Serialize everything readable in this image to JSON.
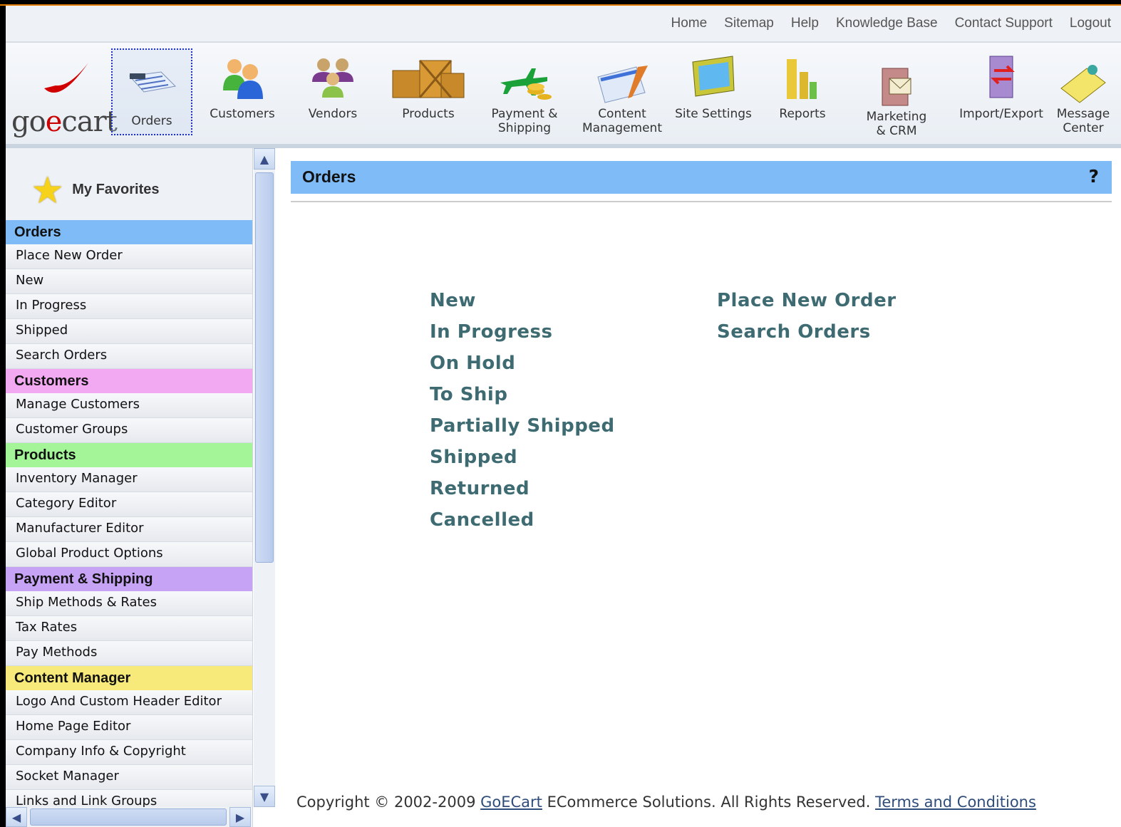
{
  "top_links": [
    "Home",
    "Sitemap",
    "Help",
    "Knowledge Base",
    "Contact Support",
    "Logout"
  ],
  "logo": {
    "text_pre": "go",
    "text_e": "e",
    "text_post": "cart"
  },
  "toolbar": [
    {
      "label": "Orders",
      "icon": "orders-icon"
    },
    {
      "label": "Customers",
      "icon": "customers-icon"
    },
    {
      "label": "Vendors",
      "icon": "vendors-icon"
    },
    {
      "label": "Products",
      "icon": "products-icon"
    },
    {
      "label": "Payment &\nShipping",
      "icon": "payment-shipping-icon"
    },
    {
      "label": "Content\nManagement",
      "icon": "content-management-icon"
    },
    {
      "label": "Site Settings",
      "icon": "site-settings-icon"
    },
    {
      "label": "Reports",
      "icon": "reports-icon"
    },
    {
      "label": "Marketing\n& CRM",
      "icon": "marketing-crm-icon"
    },
    {
      "label": "Import/Export",
      "icon": "import-export-icon"
    },
    {
      "label": "Message\nCenter",
      "icon": "message-center-icon"
    }
  ],
  "sidebar": {
    "favorites": "My Favorites",
    "sections": [
      {
        "title": "Orders",
        "color": "#7fbbf7",
        "items": [
          "Place New Order",
          "New",
          "In Progress",
          "Shipped",
          "Search Orders"
        ]
      },
      {
        "title": "Customers",
        "color": "#f2a9f2",
        "items": [
          "Manage Customers",
          "Customer Groups"
        ]
      },
      {
        "title": "Products",
        "color": "#a3f598",
        "items": [
          "Inventory Manager",
          "Category Editor",
          "Manufacturer Editor",
          "Global Product Options"
        ]
      },
      {
        "title": "Payment & Shipping",
        "color": "#c6a3f5",
        "items": [
          "Ship Methods & Rates",
          "Tax Rates",
          "Pay Methods"
        ]
      },
      {
        "title": "Content Manager",
        "color": "#f7ea7a",
        "items": [
          "Logo And Custom Header Editor",
          "Home Page Editor",
          "Company Info & Copyright",
          "Socket Manager",
          "Links and Link Groups"
        ]
      }
    ]
  },
  "main": {
    "title": "Orders",
    "help": "?",
    "left_links": [
      "New",
      "In Progress",
      "On Hold",
      "To Ship",
      "Partially Shipped",
      "Shipped",
      "Returned",
      "Cancelled"
    ],
    "right_links": [
      "Place New Order",
      "Search Orders"
    ]
  },
  "footer": {
    "pre": "Copyright © 2002-2009 ",
    "company": "GoECart",
    "mid": " ECommerce Solutions. All Rights Reserved. ",
    "terms": "Terms and Conditions"
  }
}
